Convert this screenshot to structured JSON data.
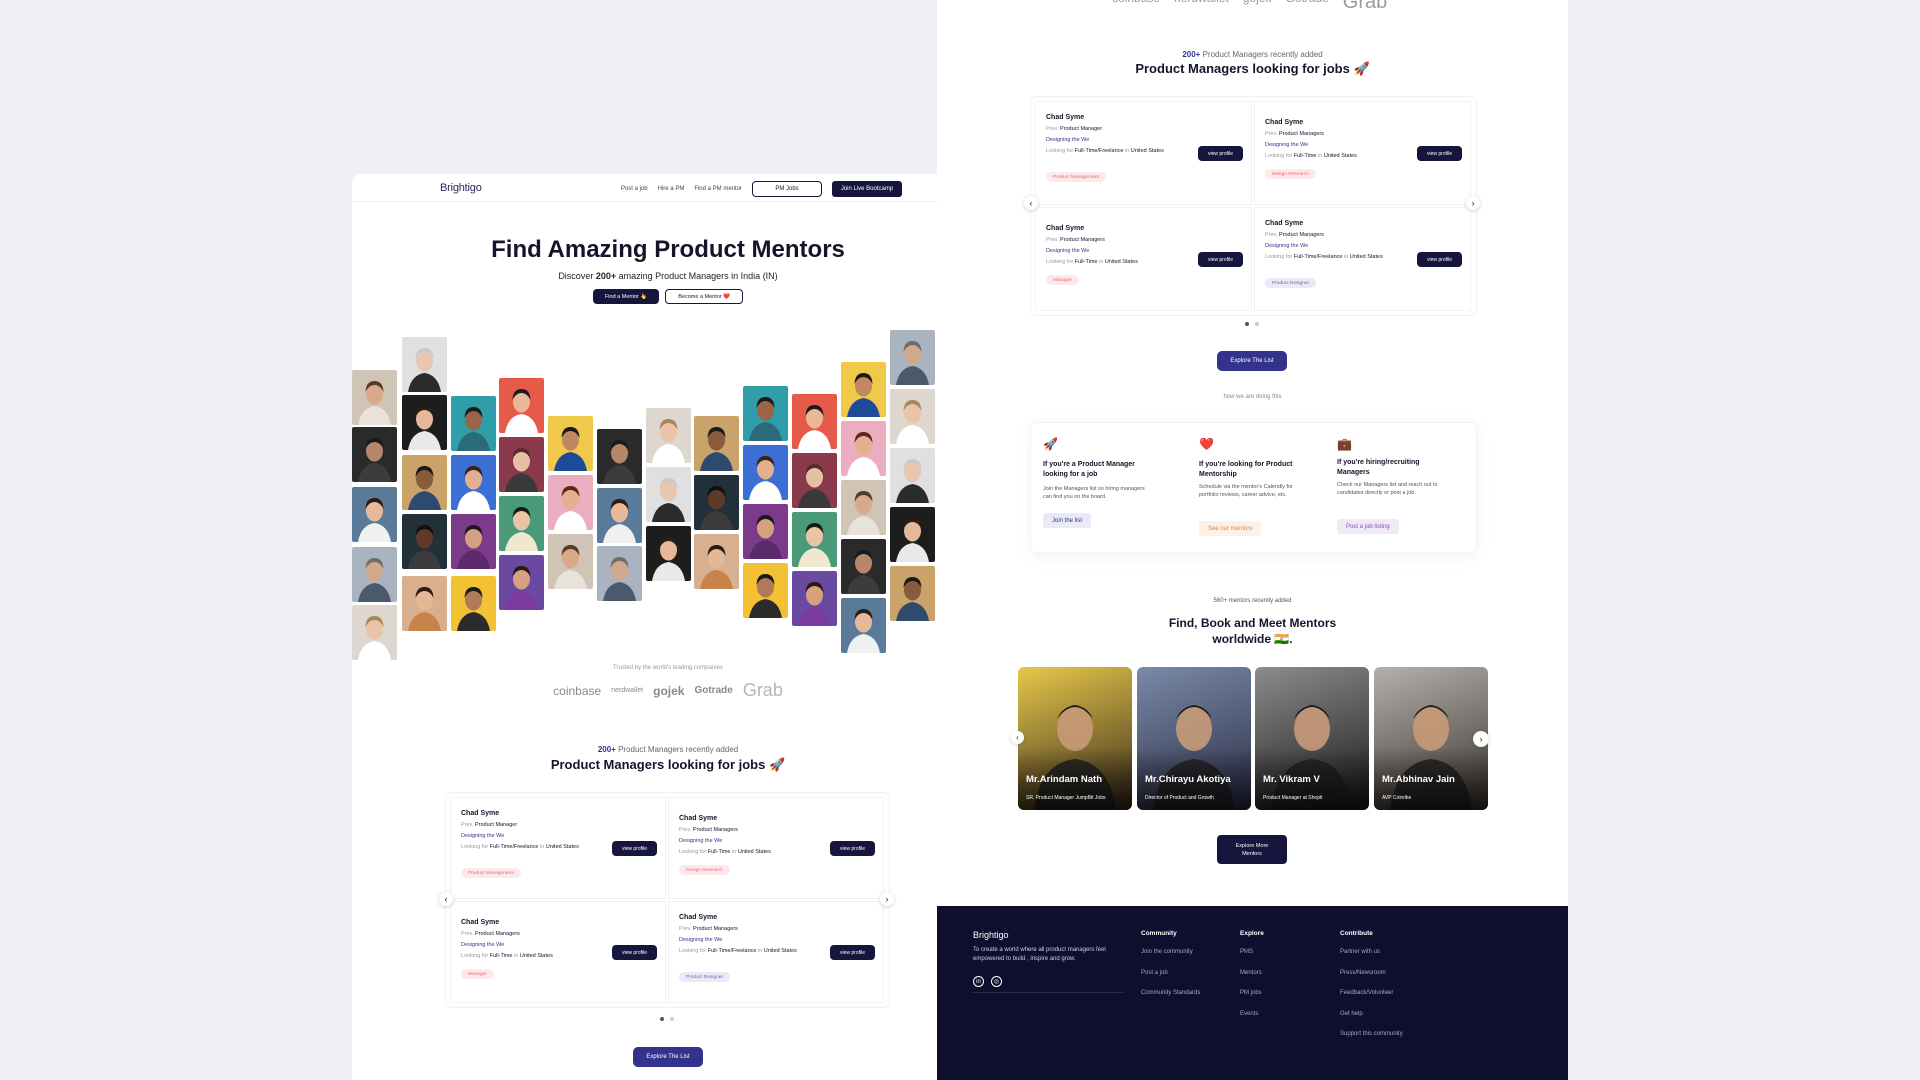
{
  "left": {
    "nav": {
      "logo": "Brightigo",
      "links": [
        "Post a job",
        "Hire a PM",
        "Find a PM mentor"
      ],
      "pm_jobs": "PM Jobs",
      "bootcamp": "Join Live Bootcamp"
    },
    "hero": {
      "title": "Find Amazing Product Mentors",
      "sub_prefix": "Discover ",
      "sub_count": "200+",
      "sub_suffix": " amazing Product Managers in India (IN)",
      "find_mentor": "Find a Mentor 👆",
      "become_mentor": "Become a Mentor ❤️"
    },
    "trusted": "Trusted by the world's leading companies",
    "logos": [
      "coinbase",
      "nerdwallet",
      "gojek",
      "Gotrade",
      "Grab"
    ],
    "jobs_section": {
      "kicker_count": "200+",
      "kicker_text": " Product Managers recently added",
      "title": "Product Managers looking for jobs 🚀",
      "explore": "Explore The List"
    }
  },
  "job_cards": [
    {
      "name": "Chad Syme",
      "prev_label": "Prev.",
      "prev": "Product Manager",
      "design": "Designing the We",
      "looking_label": "Looking for",
      "looking": "Full-Time/Freelance",
      "in_label": "in",
      "loc": "United States",
      "tag": "Product Management",
      "tag_color": "pink",
      "view": "view profile"
    },
    {
      "name": "Chad Syme",
      "prev_label": "Prev.",
      "prev": "Product Managers",
      "design": "Designing the We",
      "looking_label": "Looking for",
      "looking": "Full-Time",
      "in_label": "in",
      "loc": "United States",
      "tag": "Design Research",
      "tag_color": "pink",
      "view": "view profile"
    },
    {
      "name": "Chad Syme",
      "prev_label": "Prev.",
      "prev": "Product Managers",
      "design": "Designing the We",
      "looking_label": "Looking for",
      "looking": "Full-Time",
      "in_label": "in",
      "loc": "United States",
      "tag": "Manager",
      "tag_color": "pink",
      "view": "view profile"
    },
    {
      "name": "Chad Syme",
      "prev_label": "Prev.",
      "prev": "Product Managers",
      "design": "Designing the We",
      "looking_label": "Looking for",
      "looking": "Full-Time/Freelance",
      "in_label": "in",
      "loc": "United States",
      "tag": "Product Designer",
      "tag_color": "purple",
      "view": "view profile"
    }
  ],
  "right": {
    "top_logos": [
      "coinbase",
      "nerdwallet",
      "gojek",
      "Gotrade",
      "Grab"
    ],
    "jobs_section": {
      "kicker_count": "200+",
      "kicker_text": " Product Managers recently added",
      "title": "Product Managers looking for jobs 🚀",
      "explore": "Explore The List"
    },
    "how_label": "how we are doing this",
    "how": [
      {
        "emoji": "🚀",
        "title": "If you're a Product Manager looking for a job",
        "desc": "Join the Managers list so hiring managers can find you on the board.",
        "button": "Join the list",
        "btn_bg": "#e9e9f7",
        "btn_fg": "#33338e"
      },
      {
        "emoji": "❤️",
        "title": "If you're looking for Product Mentorship",
        "desc": "Schedule via the mentor's Calendly for portfolio reviews, career advice, etc.",
        "button": "See our mentors",
        "btn_bg": "#fdf0e6",
        "btn_fg": "#d9874a"
      },
      {
        "emoji": "💼",
        "title": "If you're hiring/recruiting Managers",
        "desc": "Check our Managers list and reach out to candidates directly or post a job.",
        "button": "Post a job listing",
        "btn_bg": "#f1e9f7",
        "btn_fg": "#8a4fa8"
      }
    ],
    "mentors_section": {
      "kicker": "560+ mentors recently added",
      "title_line1": "Find, Book and Meet Mentors",
      "title_line2": "worldwide 🇮🇳.",
      "explore": "Explore More Mentors"
    },
    "mentors": [
      {
        "name": "Mr.Arindam Nath",
        "role": "SR. Product Manager JumpBit Jobs",
        "bg1": "#e6c84a",
        "bg2": "#3a2a1c"
      },
      {
        "name": "Mr.Chirayu Akotiya",
        "role": "Director of Product and Growth",
        "bg1": "#7a8aa8",
        "bg2": "#2a2d45"
      },
      {
        "name": "Mr. Vikram V",
        "role": "Product Manager at Shopit",
        "bg1": "#8c8c8c",
        "bg2": "#1a1a1a"
      },
      {
        "name": "Mr.Abhinav Jain",
        "role": "AVP Coinrike",
        "bg1": "#b5b0aa",
        "bg2": "#3a3430"
      }
    ],
    "footer": {
      "brand": "Brightigo",
      "desc": "To create a world where all product managers feel empowered to build , inspire and grow.",
      "columns": [
        {
          "heading": "Community",
          "items": [
            "Join the community",
            "Post a job",
            "Community Standards"
          ]
        },
        {
          "heading": "Explore",
          "items": [
            "PMS",
            "Mentors",
            "PM jobs",
            "Events"
          ]
        },
        {
          "heading": "Contribute",
          "items": [
            "Partner with us",
            "Press/Newsroom",
            "Feedback/Volunteer",
            "Get help",
            "Support this community"
          ]
        }
      ]
    }
  },
  "photos": [
    {
      "bg": "#cfc4b6",
      "skin": "#d9a98a",
      "hair": "#5a3a25",
      "shirt": "#e8e2d8"
    },
    {
      "bg": "#2a2a2a",
      "skin": "#b58668",
      "hair": "#1a1a1a",
      "shirt": "#3c3c3c"
    },
    {
      "bg": "#5a7a9a",
      "skin": "#e6b99a",
      "hair": "#2b1c12",
      "shirt": "#f0f0f0"
    },
    {
      "bg": "#a9b4c0",
      "skin": "#d0a88a",
      "hair": "#6d6d6d",
      "shirt": "#4a5a6a"
    },
    {
      "bg": "#ddd7cf",
      "skin": "#e9c4a8",
      "hair": "#a8865e",
      "shirt": "#ffffff"
    },
    {
      "bg": "#e0e0e0",
      "skin": "#e8c7b0",
      "hair": "#c9c9c9",
      "shirt": "#2b2b2b"
    },
    {
      "bg": "#1d1d1d",
      "skin": "#e6b899",
      "hair": "#2d1d14",
      "shirt": "#e9e9e9"
    },
    {
      "bg": "#c9a36a",
      "skin": "#8a5a3c",
      "hair": "#1a1a1a",
      "shirt": "#2e4a6e"
    },
    {
      "bg": "#22303a",
      "skin": "#5e3a28",
      "hair": "#111111",
      "shirt": "#3b3b3b"
    },
    {
      "bg": "#d8b090",
      "skin": "#e3b896",
      "hair": "#2a1c14",
      "shirt": "#c7834a"
    },
    {
      "bg": "#2f9ea8",
      "skin": "#9a6446",
      "hair": "#1b1b1b",
      "shirt": "#2a6a7a"
    },
    {
      "bg": "#3b6fd4",
      "skin": "#e2b090",
      "hair": "#3a2414",
      "shirt": "#ffffff"
    },
    {
      "bg": "#7c3a8a",
      "skin": "#d4a080",
      "hair": "#1a1a1a",
      "shirt": "#5a2a6a"
    },
    {
      "bg": "#f3c234",
      "skin": "#b07a58",
      "hair": "#1a1a1a",
      "shirt": "#2b2b2b"
    },
    {
      "bg": "#e65a4a",
      "skin": "#e9b898",
      "hair": "#1a1a1a",
      "shirt": "#ffffff"
    },
    {
      "bg": "#8a3a4a",
      "skin": "#e6c0a4",
      "hair": "#5a2a2a",
      "shirt": "#3a3a3a"
    },
    {
      "bg": "#4a9a7a",
      "skin": "#eac3a2",
      "hair": "#1a1a1a",
      "shirt": "#f1e6d0"
    },
    {
      "bg": "#6a4aa0",
      "skin": "#d9a080",
      "hair": "#2a1a10",
      "shirt": "#7a3aa0"
    },
    {
      "bg": "#f0c84a",
      "skin": "#c08860",
      "hair": "#1a1a1a",
      "shirt": "#1e4a9a"
    },
    {
      "bg": "#eaaec0",
      "skin": "#e3b090",
      "hair": "#5a2a14",
      "shirt": "#ffffff"
    }
  ]
}
